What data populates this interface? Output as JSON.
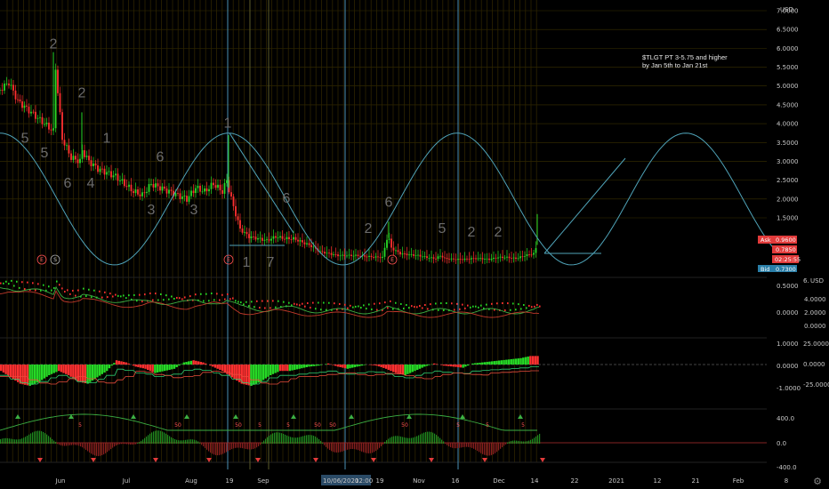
{
  "chart_data": {
    "type": "candlestick",
    "currency": "USD",
    "annotation": [
      "$TLGT PT 3-5.75 and higher",
      "by Jan 5th to Jan 21st"
    ],
    "price_axis": {
      "ticks": [
        "7.0000",
        "6.5000",
        "6.0000",
        "5.5000",
        "5.0000",
        "4.5000",
        "4.0000",
        "3.5000",
        "3.0000",
        "2.5000",
        "2.0000",
        "1.5000"
      ],
      "ylim": [
        0.2,
        7.0
      ]
    },
    "price_tags": {
      "ask_label": "Ask",
      "ask": "0.9600",
      "last": "0.7850",
      "countdown": "02:25:55",
      "bid_label": "Bid",
      "bid": "0.7300"
    },
    "time_axis": [
      "Jun",
      "Jul",
      "Aug",
      "19",
      "Sep",
      "10/06/2020",
      "12:00",
      "19",
      "Nov",
      "16",
      "Dec",
      "14",
      "22",
      "2021",
      "12",
      "21",
      "Feb",
      "8"
    ],
    "price_series": {
      "x_index": [
        0,
        10,
        20,
        30,
        40,
        50,
        60,
        62,
        70,
        80,
        90,
        92,
        100,
        110,
        120,
        130,
        140,
        150,
        160,
        170,
        180,
        190,
        200,
        210,
        220,
        230,
        240,
        250,
        255,
        260,
        265,
        270,
        280,
        290,
        300,
        310,
        320,
        330,
        340,
        350,
        360,
        370,
        380,
        390,
        400,
        410,
        420,
        430,
        436,
        440,
        450,
        460,
        470,
        480,
        490,
        495,
        500,
        510,
        520,
        530,
        540,
        550,
        560,
        570,
        580,
        590,
        600,
        604
      ],
      "close": [
        4.9,
        5.1,
        4.6,
        4.4,
        4.2,
        4.0,
        3.8,
        5.6,
        3.6,
        3.1,
        3.0,
        3.3,
        3.0,
        2.8,
        2.7,
        2.6,
        2.4,
        2.2,
        2.1,
        2.4,
        2.3,
        2.2,
        2.1,
        2.0,
        2.3,
        2.2,
        2.4,
        2.2,
        2.5,
        2.0,
        1.6,
        1.2,
        1.0,
        0.95,
        0.9,
        1.0,
        0.95,
        0.95,
        0.85,
        0.75,
        0.6,
        0.55,
        0.5,
        0.5,
        0.5,
        0.48,
        0.46,
        0.45,
        1.05,
        0.7,
        0.55,
        0.52,
        0.5,
        0.45,
        0.42,
        0.5,
        0.42,
        0.4,
        0.4,
        0.42,
        0.42,
        0.4,
        0.45,
        0.45,
        0.42,
        0.5,
        0.55,
        0.78
      ]
    },
    "wave_labels": [
      {
        "text": "2",
        "x": 60,
        "y": 6.0
      },
      {
        "text": "2",
        "x": 92,
        "y": 4.7
      },
      {
        "text": "5",
        "x": 28,
        "y": 3.5
      },
      {
        "text": "5",
        "x": 50,
        "y": 3.1
      },
      {
        "text": "1",
        "x": 120,
        "y": 3.5
      },
      {
        "text": "6",
        "x": 180,
        "y": 3.0
      },
      {
        "text": "6",
        "x": 76,
        "y": 2.3
      },
      {
        "text": "4",
        "x": 102,
        "y": 2.3
      },
      {
        "text": "3",
        "x": 170,
        "y": 1.6
      },
      {
        "text": "3",
        "x": 218,
        "y": 1.6
      },
      {
        "text": "1",
        "x": 256,
        "y": 3.9
      },
      {
        "text": "6",
        "x": 322,
        "y": 1.9
      },
      {
        "text": "1",
        "x": 277,
        "y": 0.2
      },
      {
        "text": "7",
        "x": 304,
        "y": 0.2
      },
      {
        "text": "2",
        "x": 414,
        "y": 1.1
      },
      {
        "text": "6",
        "x": 437,
        "y": 1.8
      },
      {
        "text": "5",
        "x": 497,
        "y": 1.1
      },
      {
        "text": "2",
        "x": 530,
        "y": 1.0
      },
      {
        "text": "2",
        "x": 560,
        "y": 1.0
      }
    ],
    "cycle_overlay": {
      "amplitude": 1.75,
      "center": 2.0,
      "period_px": 257,
      "peak_x": 257
    },
    "earnings_markers": [
      {
        "label": "E",
        "x": 47
      },
      {
        "label": "S",
        "x": 62
      },
      {
        "label": "E",
        "x": 257
      },
      {
        "label": "E",
        "x": 441
      }
    ],
    "panel_1": {
      "ticks": [
        "0.5000",
        "0.0000"
      ],
      "right_label": "6.",
      "right_ticks": [
        "4.0000",
        "2.0000",
        "0.0000"
      ],
      "currency": "USD"
    },
    "panel_2": {
      "ticks": [
        "1.0000",
        "0.0000",
        "-1.0000"
      ],
      "right_ticks": [
        "25.0000",
        "0.0000",
        "-25.0000"
      ],
      "histogram": [
        -0.3,
        -0.6,
        -0.9,
        -1.0,
        -0.8,
        -0.5,
        -0.3,
        -0.5,
        -0.8,
        -0.9,
        -0.6,
        -0.3,
        0.2,
        0.1,
        -0.1,
        -0.2,
        -0.4,
        -0.3,
        -0.2,
        0.1,
        0.2,
        0.1,
        -0.1,
        -0.3,
        -0.6,
        -0.9,
        -1.0,
        -0.8,
        -0.5,
        -0.3,
        -0.3,
        -0.2,
        -0.1,
        -0.05,
        0.05,
        -0.1,
        -0.2,
        -0.1,
        0.0,
        -0.05,
        -0.2,
        -0.4,
        -0.5,
        -0.3,
        -0.1,
        0.05,
        -0.05,
        -0.1,
        -0.15,
        0.05,
        0.1,
        0.15,
        0.2,
        0.25,
        0.3,
        0.4
      ]
    },
    "panel_3": {
      "ticks": [
        "400.0",
        "0.0",
        "-400.0"
      ],
      "signal_labels": [
        "50",
        "50",
        "50",
        "50",
        "50",
        "5",
        "5",
        "5",
        "5",
        "5",
        "5"
      ]
    }
  },
  "colors": {
    "up": "#26d926",
    "down": "#ff3030",
    "grid": "#3a3000",
    "vline": "#4a8fb5",
    "cycle": "#4fa3b8",
    "panel_bg": "#000000"
  }
}
